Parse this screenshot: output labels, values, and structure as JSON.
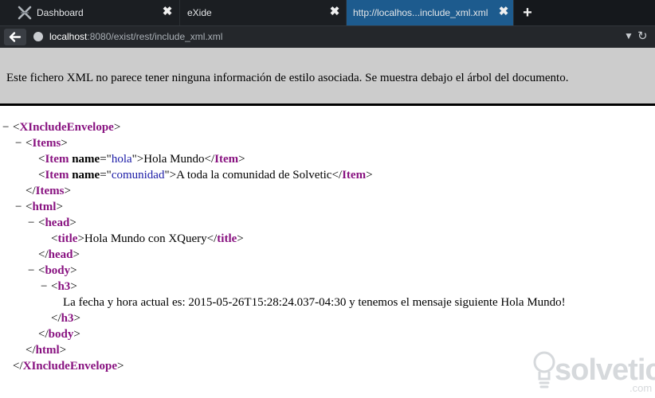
{
  "browser": {
    "tabs": [
      {
        "label": "Dashboard",
        "icon": "exist-x-icon",
        "active": false
      },
      {
        "label": "eXide",
        "icon": "",
        "active": false
      },
      {
        "label": "http://localhos...include_xml.xml",
        "icon": "",
        "active": true
      }
    ],
    "close_glyph": "✖",
    "new_tab_glyph": "+",
    "back_glyph": "←",
    "url_host": "localhost",
    "url_rest": ":8080/exist/rest/include_xml.xml",
    "url_dropdown_glyph": "▼",
    "reload_glyph": "↻",
    "accent_color": "#1d5b8e"
  },
  "page": {
    "info_message": "Este fichero XML no parece tener ninguna información de estilo asociada. Se muestra debajo el árbol del documento.",
    "fold_glyph": "−",
    "tree": {
      "root_tag": "XIncludeEnvelope",
      "items_tag": "Items",
      "item_tag": "Item",
      "attr_name": "name",
      "item1_attr": "hola",
      "item1_text": "Hola Mundo",
      "item2_attr": "comunidad",
      "item2_text": "A toda la comunidad de Solvetic",
      "html_tag": "html",
      "head_tag": "head",
      "title_tag": "title",
      "title_text": "Hola Mundo con XQuery",
      "body_tag": "body",
      "h3_tag": "h3",
      "h3_text": "La fecha y hora actual es: 2015-05-26T15:28:24.037-04:30 y tenemos el mensaje siguiente Hola Mundo!"
    }
  },
  "watermark": {
    "text": "solvetic",
    "domain": ".com"
  }
}
